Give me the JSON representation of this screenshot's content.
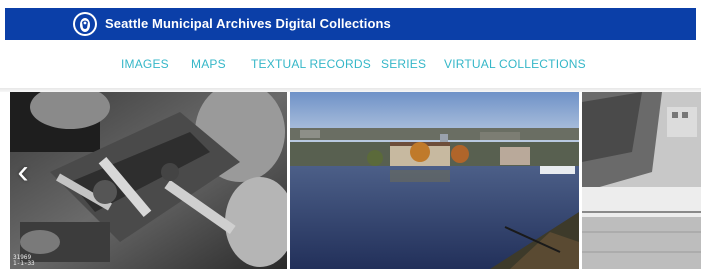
{
  "header": {
    "title": "Seattle Municipal Archives Digital Collections",
    "background": "#0b3fa8",
    "logo_icon": "seattle-city-seal-icon"
  },
  "nav": {
    "color": "#35b7c8",
    "items": [
      {
        "label": "IMAGES"
      },
      {
        "label": "MAPS"
      },
      {
        "label": "TEXTUAL RECORDS"
      },
      {
        "label": "SERIES"
      },
      {
        "label": "VIRTUAL COLLECTIONS"
      }
    ]
  },
  "carousel": {
    "prev_icon": "chevron-left-icon",
    "slides": [
      {
        "name": "industrial machinery black and white photo",
        "caption": "31969\n1-1-33"
      },
      {
        "name": "waterfront building across the water color photo"
      },
      {
        "name": "hillside construction black and white photo"
      }
    ]
  }
}
